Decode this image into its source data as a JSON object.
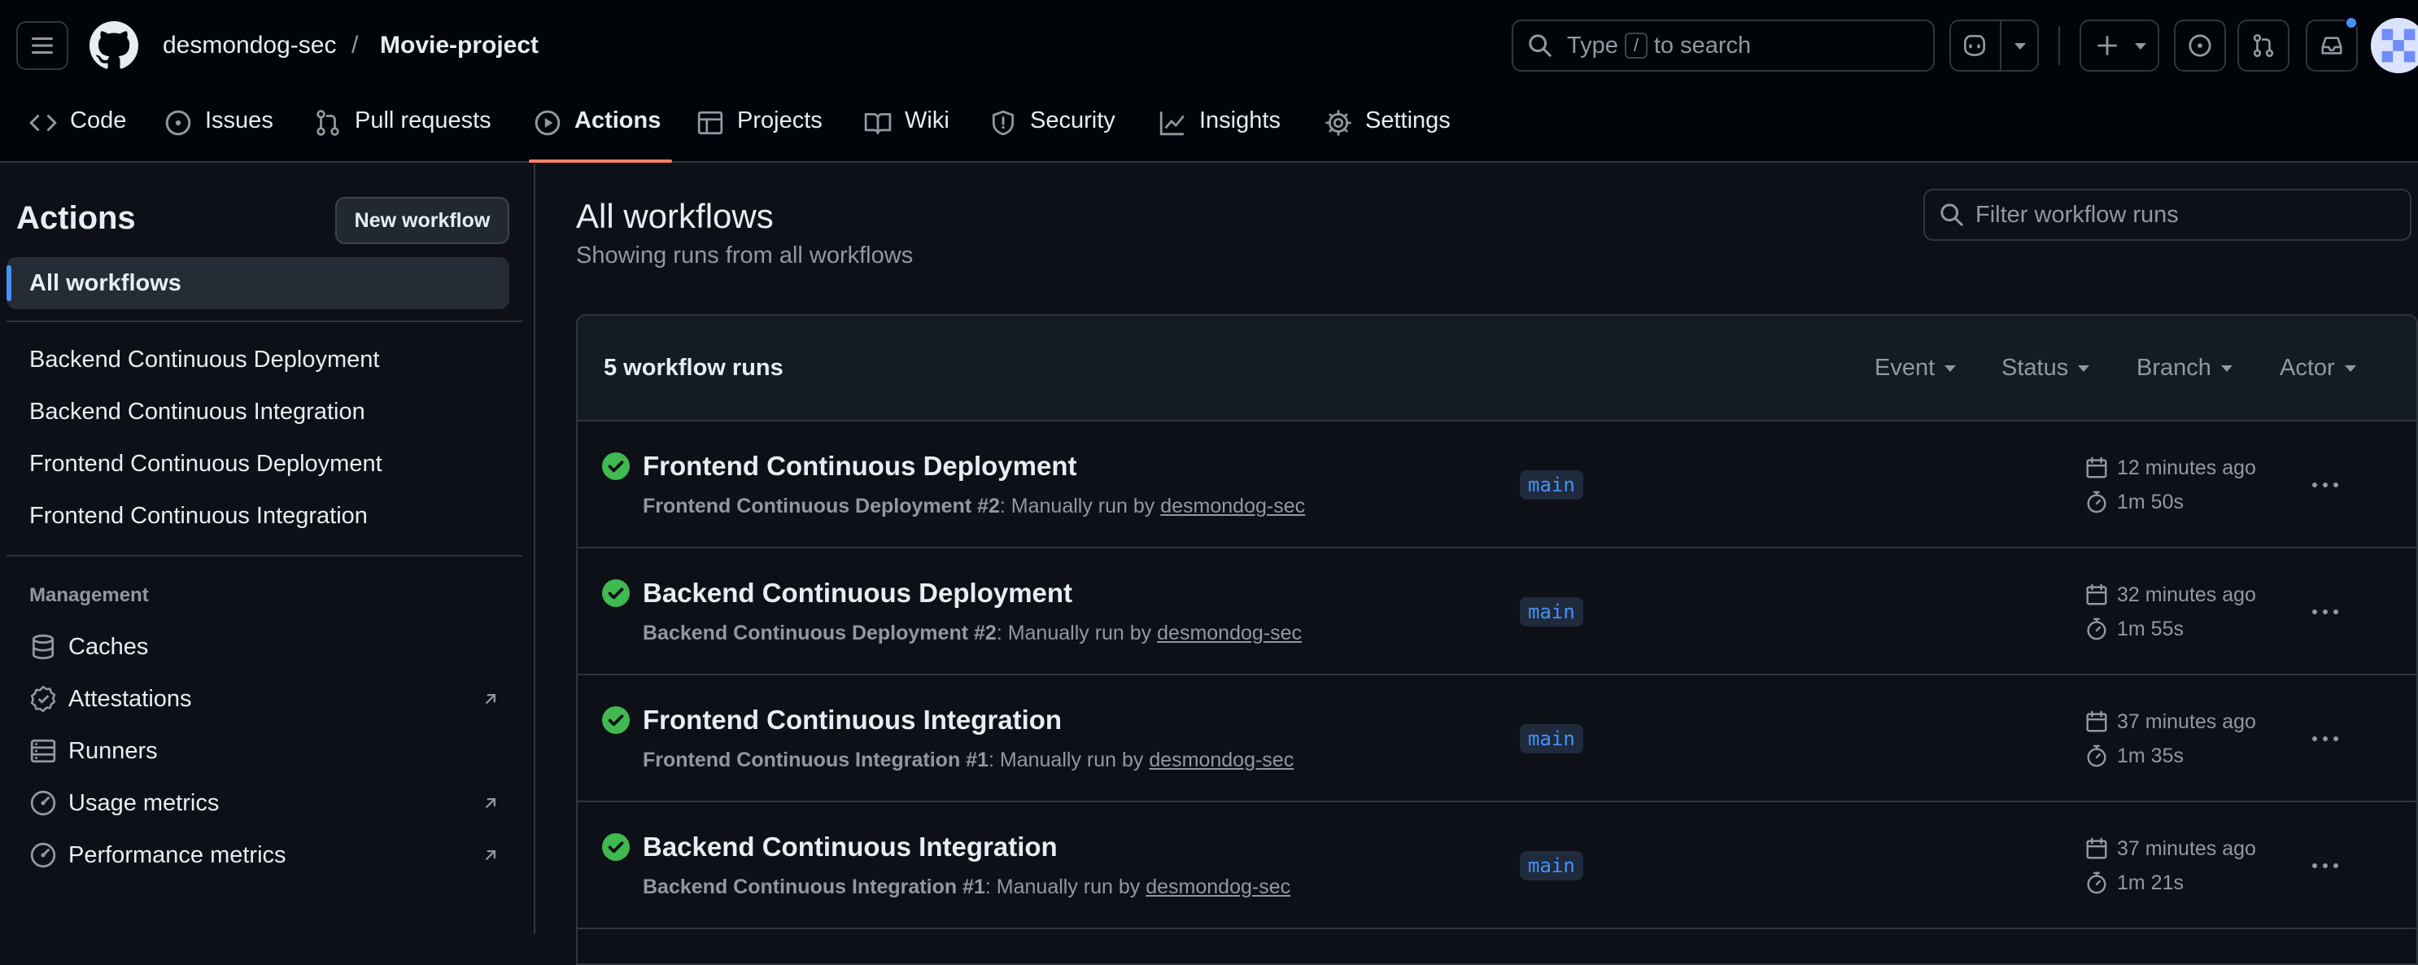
{
  "header": {
    "owner": "desmondog-sec",
    "separator": "/",
    "repo": "Movie-project",
    "search_prefix": "Type",
    "search_key": "/",
    "search_suffix": "to search"
  },
  "tabs": [
    {
      "label": "Code",
      "icon": "code-icon"
    },
    {
      "label": "Issues",
      "icon": "issue-icon"
    },
    {
      "label": "Pull requests",
      "icon": "pull-request-icon"
    },
    {
      "label": "Actions",
      "icon": "play-icon"
    },
    {
      "label": "Projects",
      "icon": "table-icon"
    },
    {
      "label": "Wiki",
      "icon": "book-icon"
    },
    {
      "label": "Security",
      "icon": "shield-icon"
    },
    {
      "label": "Insights",
      "icon": "graph-icon"
    },
    {
      "label": "Settings",
      "icon": "gear-icon"
    }
  ],
  "sidebar": {
    "title": "Actions",
    "new_workflow": "New workflow",
    "all_workflows": "All workflows",
    "workflows": [
      "Backend Continuous Deployment",
      "Backend Continuous Integration",
      "Frontend Continuous Deployment",
      "Frontend Continuous Integration"
    ],
    "management_heading": "Management",
    "management": [
      {
        "label": "Caches",
        "icon": "database-icon"
      },
      {
        "label": "Attestations",
        "icon": "verified-icon"
      },
      {
        "label": "Runners",
        "icon": "server-icon"
      },
      {
        "label": "Usage metrics",
        "icon": "meter-icon"
      },
      {
        "label": "Performance metrics",
        "icon": "meter-icon"
      }
    ]
  },
  "main": {
    "title": "All workflows",
    "subtitle": "Showing runs from all workflows",
    "filter_placeholder": "Filter workflow runs",
    "run_count": "5 workflow runs",
    "filters": [
      "Event",
      "Status",
      "Branch",
      "Actor"
    ],
    "runs": [
      {
        "title": "Frontend Continuous Deployment",
        "workflow": "Frontend Continuous Deployment",
        "number": "#2",
        "trigger": ": Manually run by ",
        "actor": "desmondog-sec",
        "branch": "main",
        "when": "12 minutes ago",
        "duration": "1m 50s"
      },
      {
        "title": "Backend Continuous Deployment",
        "workflow": "Backend Continuous Deployment",
        "number": "#2",
        "trigger": ": Manually run by ",
        "actor": "desmondog-sec",
        "branch": "main",
        "when": "32 minutes ago",
        "duration": "1m 55s"
      },
      {
        "title": "Frontend Continuous Integration",
        "workflow": "Frontend Continuous Integration",
        "number": "#1",
        "trigger": ": Manually run by ",
        "actor": "desmondog-sec",
        "branch": "main",
        "when": "37 minutes ago",
        "duration": "1m 35s"
      },
      {
        "title": "Backend Continuous Integration",
        "workflow": "Backend Continuous Integration",
        "number": "#1",
        "trigger": ": Manually run by ",
        "actor": "desmondog-sec",
        "branch": "main",
        "when": "37 minutes ago",
        "duration": "1m 21s"
      }
    ]
  },
  "colors": {
    "accent": "#4493f8",
    "success": "#3fb950",
    "tab_underline": "#f78166"
  }
}
